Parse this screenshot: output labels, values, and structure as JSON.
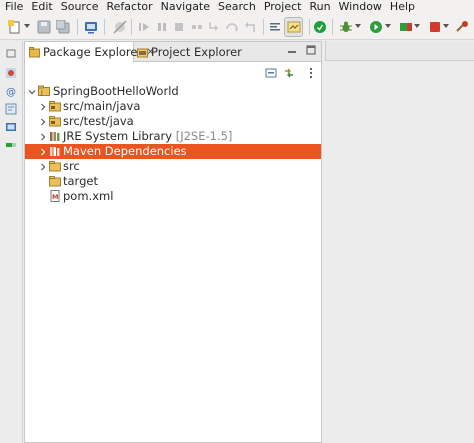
{
  "menu": [
    "File",
    "Edit",
    "Source",
    "Refactor",
    "Navigate",
    "Search",
    "Project",
    "Run",
    "Window",
    "Help"
  ],
  "colors": {
    "selection": "#e95420",
    "menubar": "#f2f1f0",
    "view_bg": "#ffffff"
  },
  "toolbar": {
    "icons": [
      "new-icon",
      "save-icon",
      "save-all-icon",
      "open-console-icon",
      "skip-breakpoints-icon",
      "resume-icon",
      "suspend-icon",
      "terminate-icon",
      "disconnect-icon",
      "step-into-icon",
      "step-over-icon",
      "step-return-icon",
      "toggle-mark-occurrences-icon",
      "toggle-breadcrumb-icon",
      "spring-boot-dashboard-icon",
      "debug-icon",
      "run-icon",
      "coverage-icon",
      "stop-icon",
      "external-tools-icon"
    ]
  },
  "views": {
    "tabs": [
      {
        "label": "Package Explorer",
        "icon": "package-explorer-icon",
        "active": true
      },
      {
        "label": "Project Explorer",
        "icon": "project-explorer-icon",
        "active": false
      }
    ],
    "close_glyph": "✕"
  },
  "tree": {
    "items": [
      {
        "label": "SpringBootHelloWorld",
        "icon": "java-project-icon",
        "expanded": true,
        "level": 0
      },
      {
        "label": "src/main/java",
        "icon": "source-folder-icon",
        "expanded": false,
        "level": 1
      },
      {
        "label": "src/test/java",
        "icon": "source-folder-icon",
        "expanded": false,
        "level": 1
      },
      {
        "label": "JRE System Library",
        "decoration": "[J2SE-1.5]",
        "icon": "library-icon",
        "expanded": false,
        "level": 1
      },
      {
        "label": "Maven Dependencies",
        "icon": "library-icon",
        "expanded": false,
        "level": 1,
        "selected": true
      },
      {
        "label": "src",
        "icon": "folder-icon",
        "expanded": false,
        "level": 1
      },
      {
        "label": "target",
        "icon": "folder-icon",
        "level": 1
      },
      {
        "label": "pom.xml",
        "icon": "maven-pom-icon",
        "level": 1
      }
    ]
  }
}
